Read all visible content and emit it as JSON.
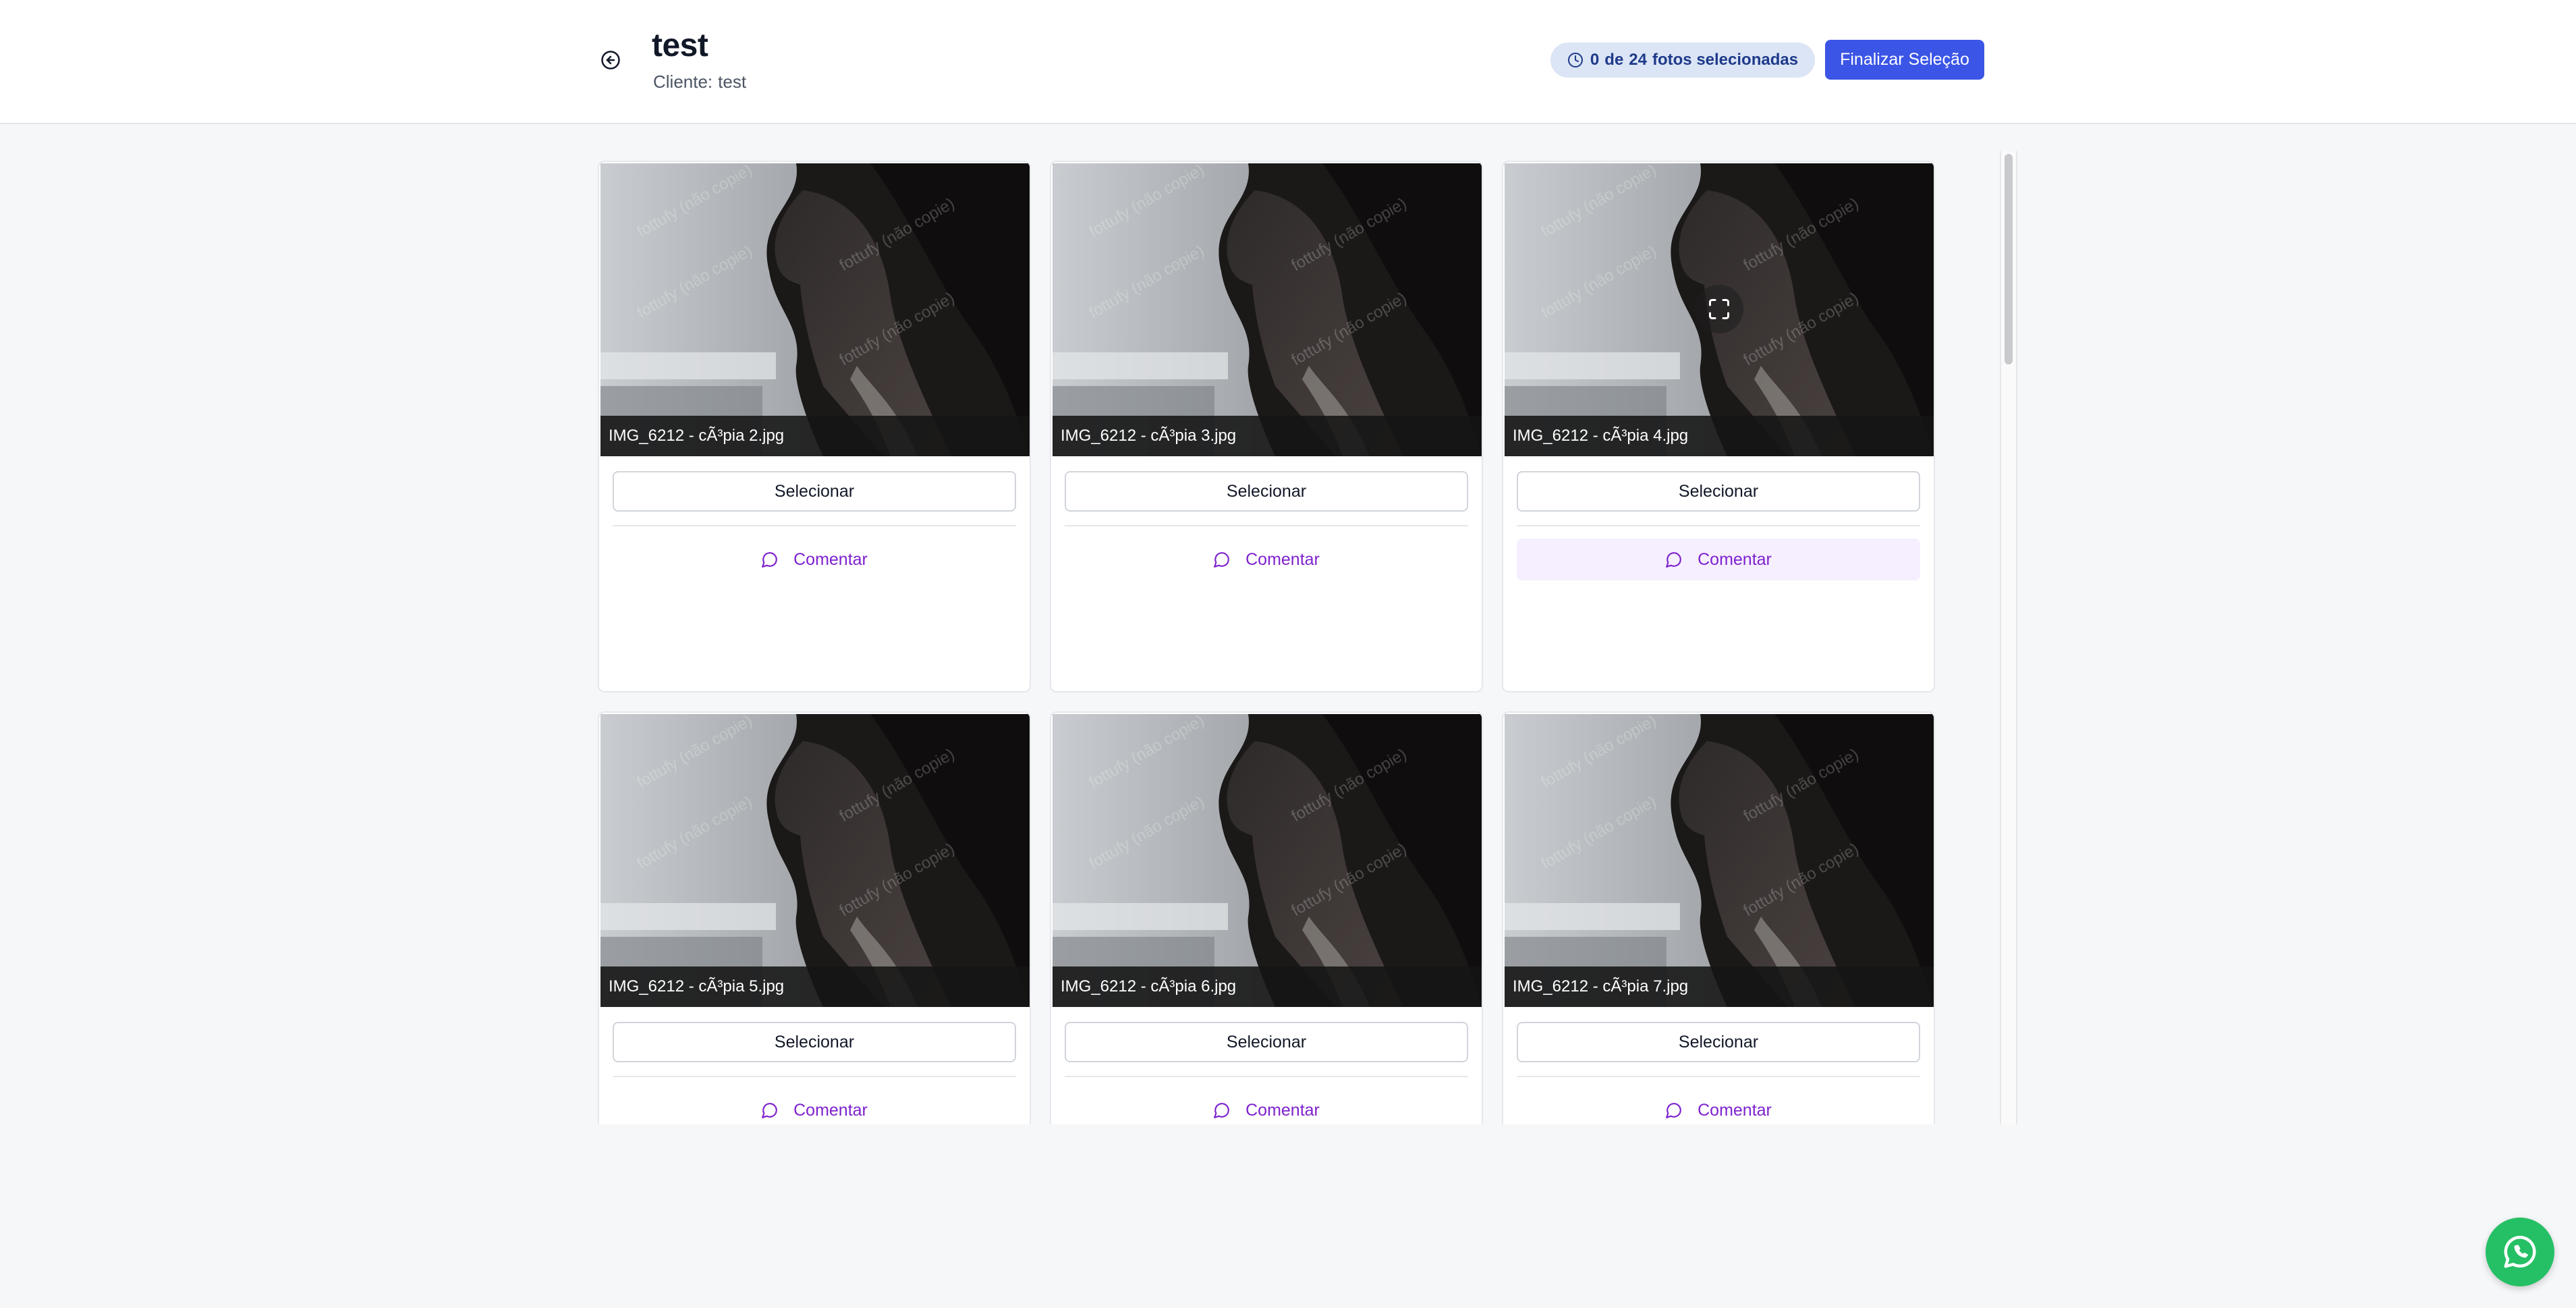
{
  "header": {
    "title": "test",
    "client_label": "Cliente:",
    "client_name": "test",
    "selection_badge": {
      "selected": "0",
      "of_label": "de",
      "total": "24",
      "suffix": "fotos selecionadas"
    },
    "finalize_label": "Finalizar Seleção"
  },
  "photo_watermark": "fottufy (não copie)",
  "photos": [
    {
      "filename": "IMG_6212 - cÃ³pia 2.jpg",
      "select_label": "Selecionar",
      "comment_label": "Comentar"
    },
    {
      "filename": "IMG_6212 - cÃ³pia 3.jpg",
      "select_label": "Selecionar",
      "comment_label": "Comentar"
    },
    {
      "filename": "IMG_6212 - cÃ³pia 4.jpg",
      "select_label": "Selecionar",
      "comment_label": "Comentar"
    },
    {
      "filename": "IMG_6212 - cÃ³pia 5.jpg",
      "select_label": "Selecionar",
      "comment_label": "Comentar"
    },
    {
      "filename": "IMG_6212 - cÃ³pia 6.jpg",
      "select_label": "Selecionar",
      "comment_label": "Comentar"
    },
    {
      "filename": "IMG_6212 - cÃ³pia 7.jpg",
      "select_label": "Selecionar",
      "comment_label": "Comentar"
    }
  ],
  "colors": {
    "primary": "#3b55e6",
    "comment": "#7e22ce",
    "badge_bg": "#dbe5f5",
    "whatsapp": "#25c065"
  },
  "icons": {
    "back": "arrow-left-circle-icon",
    "badge": "clock-icon",
    "comment": "message-circle-icon",
    "expand": "maximize-icon",
    "floating": "whatsapp-icon"
  }
}
